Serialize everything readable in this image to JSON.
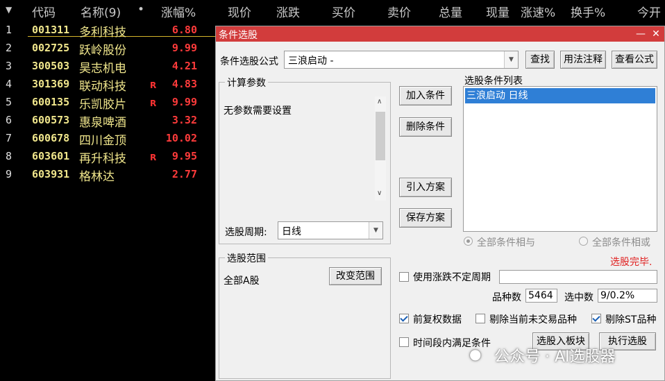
{
  "table": {
    "columns": {
      "sort_arrow": "▼",
      "code": "代码",
      "name": "名称(9)",
      "dot": "•",
      "change_pct": "涨幅%",
      "price": "现价",
      "change": "涨跌",
      "bid": "买价",
      "ask": "卖价",
      "volume": "总量",
      "cur_volume": "现量",
      "speed": "涨速%",
      "turnover": "换手%",
      "open": "今开"
    },
    "rows": [
      {
        "idx": "1",
        "code": "001311",
        "name": "多利科技",
        "flag": "",
        "pct": "6.80"
      },
      {
        "idx": "2",
        "code": "002725",
        "name": "跃岭股份",
        "flag": "",
        "pct": "9.99"
      },
      {
        "idx": "3",
        "code": "300503",
        "name": "昊志机电",
        "flag": "",
        "pct": "4.21"
      },
      {
        "idx": "4",
        "code": "301369",
        "name": "联动科技",
        "flag": "R",
        "pct": "4.83"
      },
      {
        "idx": "5",
        "code": "600135",
        "name": "乐凯胶片",
        "flag": "R",
        "pct": "9.99"
      },
      {
        "idx": "6",
        "code": "600573",
        "name": "惠泉啤酒",
        "flag": "",
        "pct": "3.32"
      },
      {
        "idx": "7",
        "code": "600678",
        "name": "四川金顶",
        "flag": "",
        "pct": "10.02"
      },
      {
        "idx": "8",
        "code": "603601",
        "name": "再升科技",
        "flag": "R",
        "pct": "9.95"
      },
      {
        "idx": "9",
        "code": "603931",
        "name": "格林达",
        "flag": "",
        "pct": "2.77"
      }
    ]
  },
  "dialog": {
    "title": "条件选股",
    "minimize": "—",
    "close": "✕",
    "formula_label": "条件选股公式",
    "formula_value": "三浪启动  -",
    "find_btn": "查找",
    "usage_btn": "用法注释",
    "view_formula_btn": "查看公式",
    "params_group": "计算参数",
    "params_text": "无参数需要设置",
    "period_label": "选股周期:",
    "period_value": "日线",
    "add_cond_btn": "加入条件",
    "del_cond_btn": "删除条件",
    "import_btn": "引入方案",
    "save_btn": "保存方案",
    "cond_list_label": "选股条件列表",
    "cond_items": [
      "三浪启动  日线"
    ],
    "radio_and": "全部条件相与",
    "radio_or": "全部条件相或",
    "status": "选股完毕.",
    "range_group": "选股范围",
    "range_value": "全部A股",
    "change_range_btn": "改变范围",
    "use_var_period": "使用涨跌不定周期",
    "count_label": "品种数",
    "count_value": "5464",
    "selected_label": "选中数",
    "selected_value": "9/0.2%",
    "fq_label": "前复权数据",
    "excl_untraded": "剔除当前未交易品种",
    "excl_st": "剔除ST品种",
    "time_cond": "时间段内满足条件",
    "to_board_btn": "选股入板块",
    "run_btn": "执行选股"
  },
  "watermark": "公众号 · AI选股器"
}
